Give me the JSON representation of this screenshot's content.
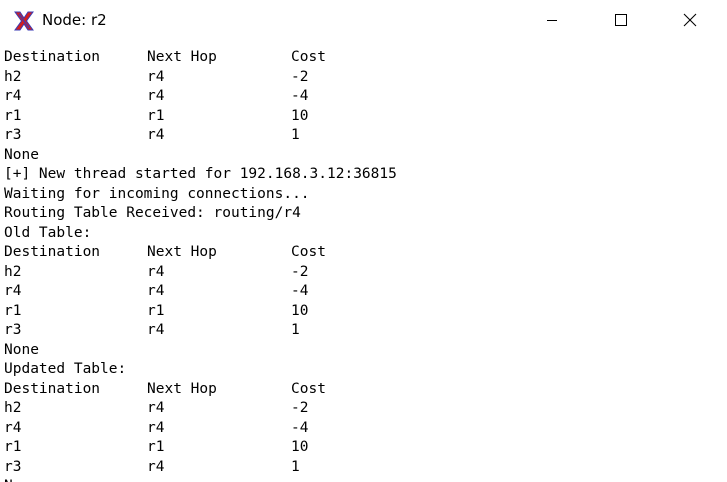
{
  "window": {
    "title": "Node: r2",
    "icon": "x-app-icon",
    "controls": {
      "minimize": "minimize-icon",
      "maximize": "maximize-icon",
      "close": "close-icon"
    }
  },
  "terminal": {
    "table1": {
      "header": [
        "Destination",
        "Next Hop",
        "Cost"
      ],
      "rows": [
        [
          "h2",
          "r4",
          "-2"
        ],
        [
          "r4",
          "r4",
          "-4"
        ],
        [
          "r1",
          "r1",
          "10"
        ],
        [
          "r3",
          "r4",
          "1"
        ]
      ]
    },
    "line_none_1": "None",
    "line_thread": "[+] New thread started for 192.168.3.12:36815",
    "line_waiting": "Waiting for incoming connections...",
    "line_received": "Routing Table Received: routing/r4",
    "line_old": "Old Table:",
    "table2": {
      "header": [
        "Destination",
        "Next Hop",
        "Cost"
      ],
      "rows": [
        [
          "h2",
          "r4",
          "-2"
        ],
        [
          "r4",
          "r4",
          "-4"
        ],
        [
          "r1",
          "r1",
          "10"
        ],
        [
          "r3",
          "r4",
          "1"
        ]
      ]
    },
    "line_none_2": "None",
    "line_updated": "Updated Table:",
    "table3": {
      "header": [
        "Destination",
        "Next Hop",
        "Cost"
      ],
      "rows": [
        [
          "h2",
          "r4",
          "-2"
        ],
        [
          "r4",
          "r4",
          "-4"
        ],
        [
          "r1",
          "r1",
          "10"
        ],
        [
          "r3",
          "r4",
          "1"
        ]
      ]
    },
    "line_partial": "N"
  }
}
